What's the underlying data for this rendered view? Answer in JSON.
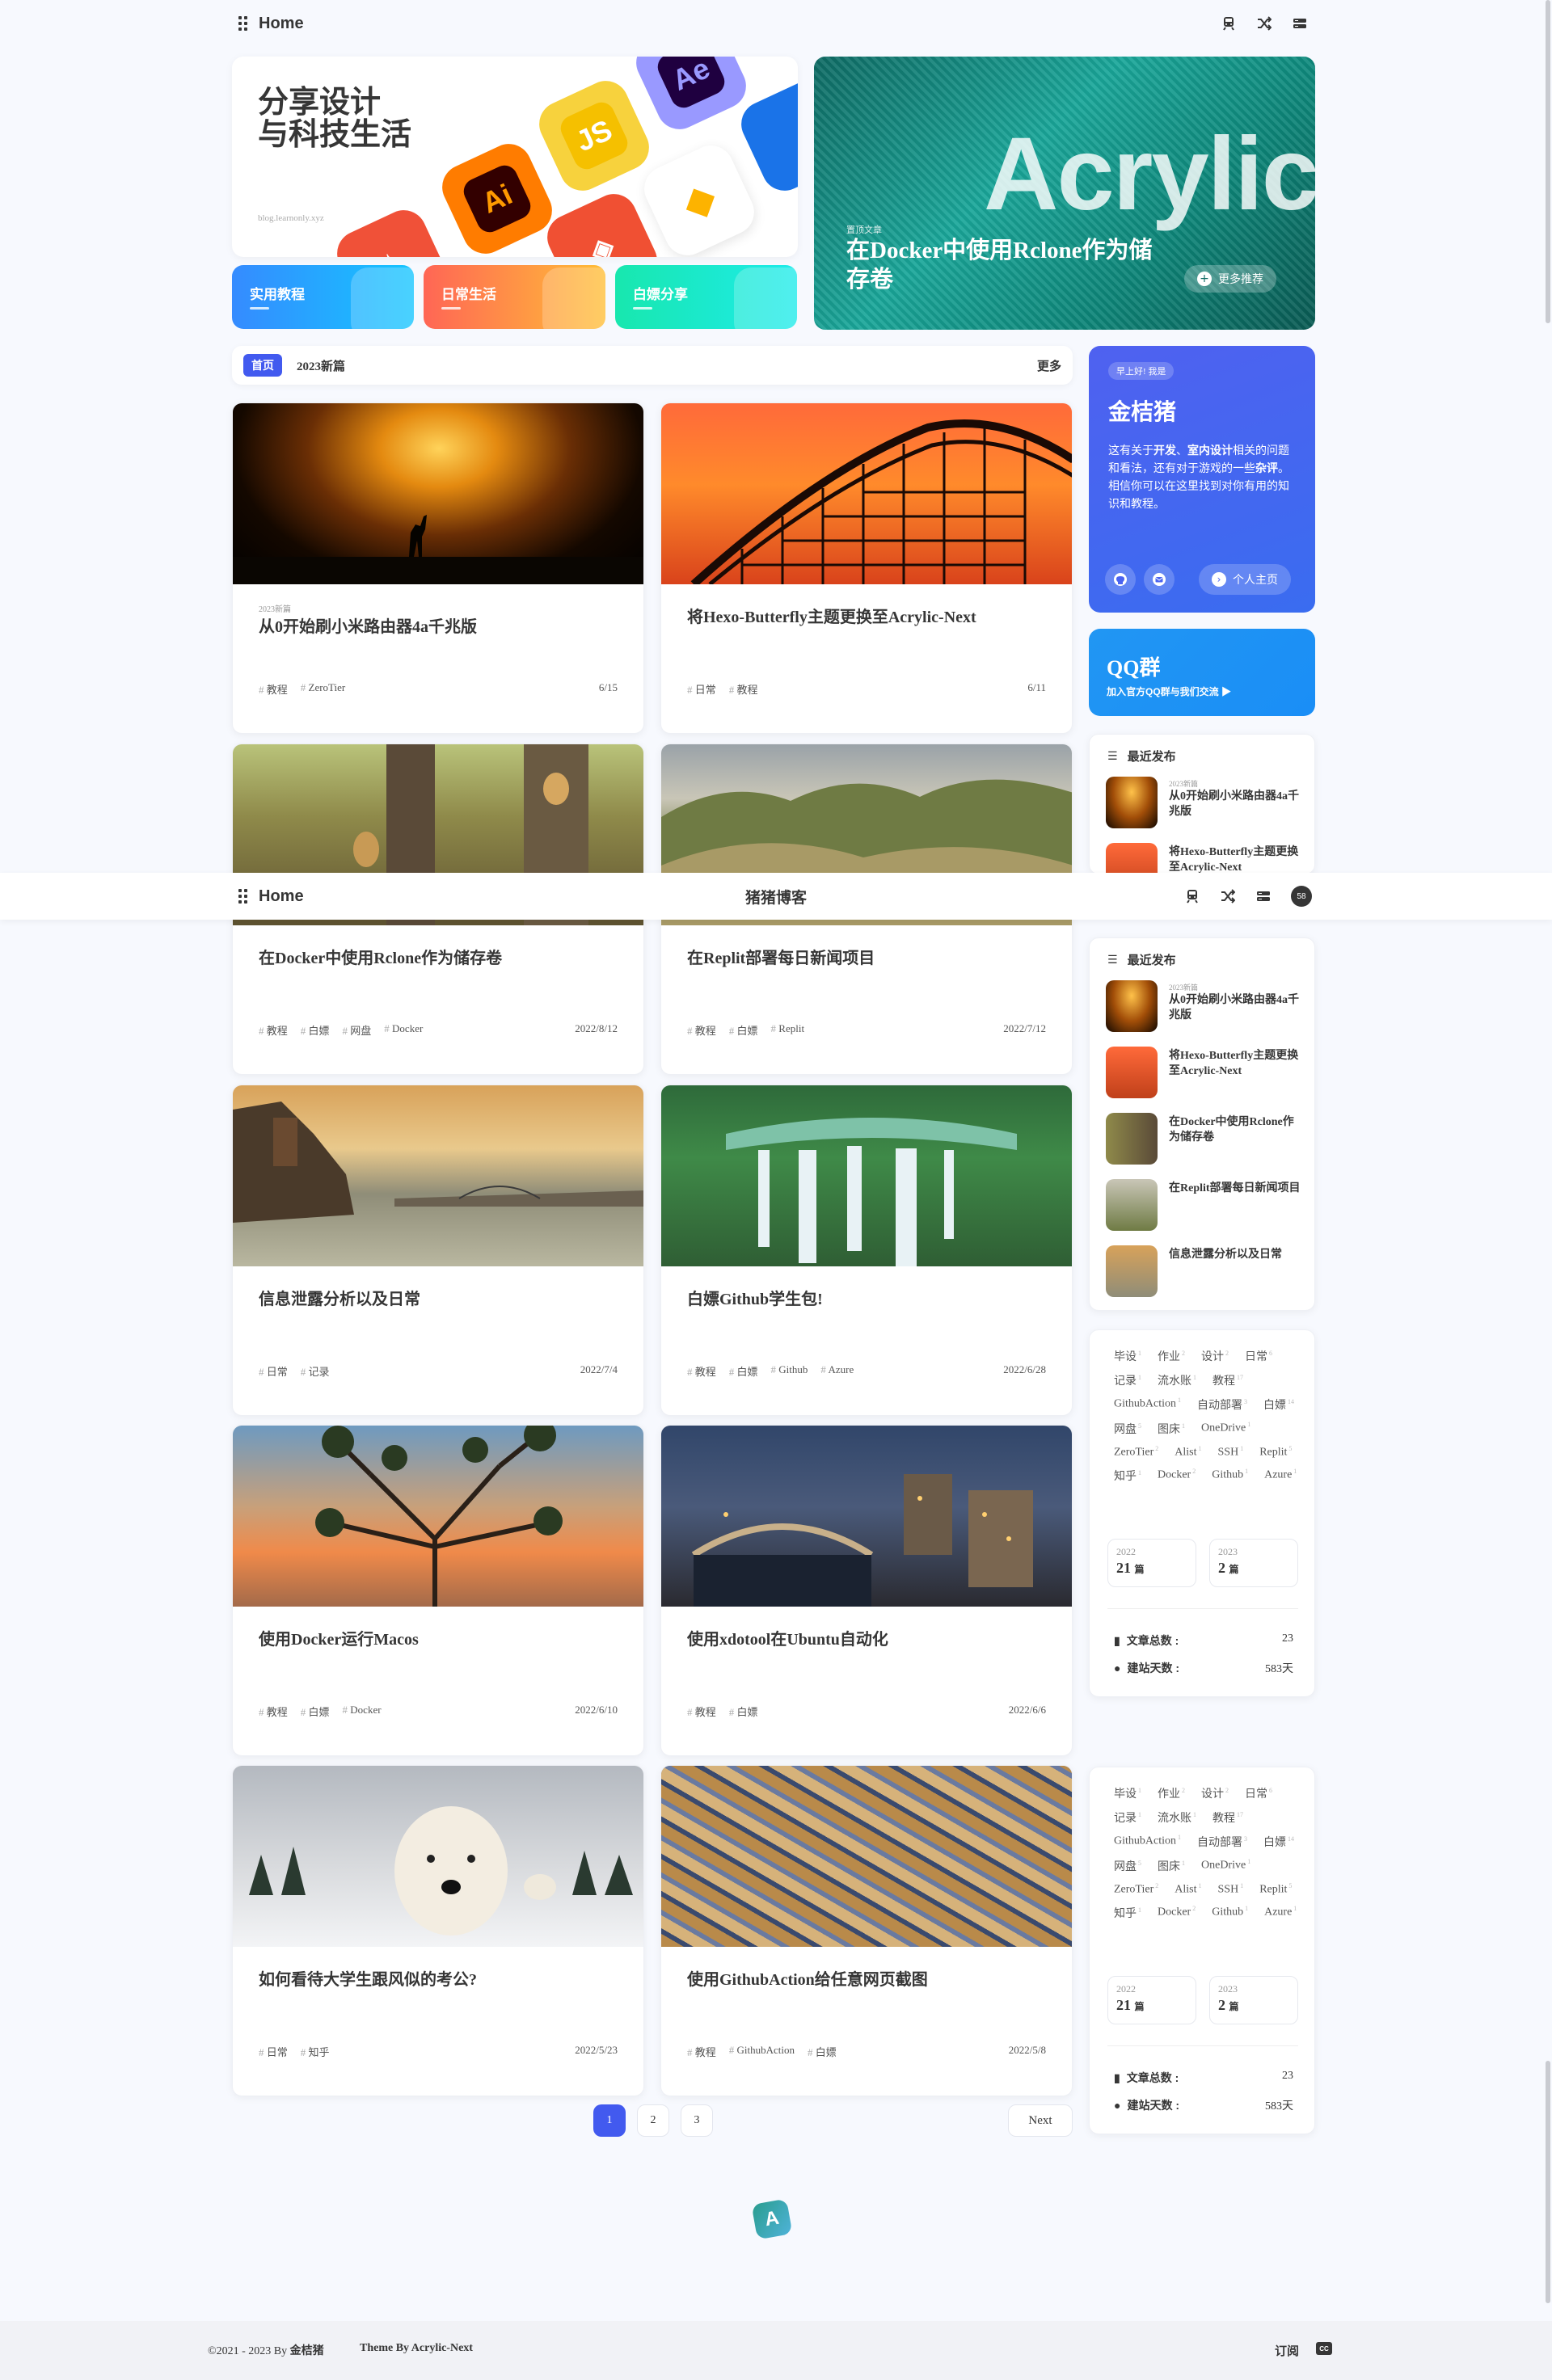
{
  "nav": {
    "home": "Home",
    "site_title": "猪猪博客",
    "icons": [
      "subway-icon",
      "shuffle-icon",
      "list-icon"
    ],
    "badge": "58"
  },
  "hero": {
    "slogan_line1": "分享设计",
    "slogan_line2": "与科技生活",
    "site": "blog.learnonly.xyz",
    "apps": [
      "Ai",
      "JS",
      "Ae"
    ],
    "categories": [
      {
        "label": "实用教程",
        "color": "#358bff"
      },
      {
        "label": "日常生活",
        "color": "#f7743a"
      },
      {
        "label": "白嫖分享",
        "color": "#18e7ae"
      }
    ],
    "featured": {
      "big_word": "Acrylic",
      "tag": "置顶文章",
      "title": "在Docker中使用Rclone作为储存卷",
      "more": "更多推荐"
    }
  },
  "catbar": {
    "pill": "首页",
    "text": "2023新篇",
    "more": "更多"
  },
  "posts": [
    {
      "label": "2023新篇",
      "title": "从0开始刷小米路由器4a千兆版",
      "tags": [
        "教程",
        "ZeroTier"
      ],
      "date": "6/15"
    },
    {
      "label": "",
      "title": "将Hexo-Butterfly主题更换至Acrylic-Next",
      "tags": [
        "日常",
        "教程"
      ],
      "date": "6/11"
    },
    {
      "label": "",
      "title": "在Docker中使用Rclone作为储存卷",
      "tags": [
        "教程",
        "白嫖",
        "网盘",
        "Docker"
      ],
      "date": "2022/8/12"
    },
    {
      "label": "",
      "title": "在Replit部署每日新闻项目",
      "tags": [
        "教程",
        "白嫖",
        "Replit"
      ],
      "date": "2022/7/12"
    },
    {
      "label": "",
      "title": "信息泄露分析以及日常",
      "tags": [
        "日常",
        "记录"
      ],
      "date": "2022/7/4"
    },
    {
      "label": "",
      "title": "白嫖Github学生包!",
      "tags": [
        "教程",
        "白嫖",
        "Github",
        "Azure"
      ],
      "date": "2022/6/28"
    },
    {
      "label": "",
      "title": "使用Docker运行Macos",
      "tags": [
        "教程",
        "白嫖",
        "Docker"
      ],
      "date": "2022/6/10"
    },
    {
      "label": "",
      "title": "使用xdotool在Ubuntu自动化",
      "tags": [
        "教程",
        "白嫖"
      ],
      "date": "2022/6/6"
    },
    {
      "label": "",
      "title": "如何看待大学生跟风似的考公?",
      "tags": [
        "日常",
        "知乎"
      ],
      "date": "2022/5/23"
    },
    {
      "label": "",
      "title": "使用GithubAction给任意网页截图",
      "tags": [
        "教程",
        "GithubAction",
        "白嫖"
      ],
      "date": "2022/5/8"
    }
  ],
  "author": {
    "greet": "早上好! 我是",
    "name": "金桔猪",
    "desc_1": "这有关于",
    "desc_b1": "开发",
    "desc_2": "、",
    "desc_b2": "室内设计",
    "desc_3": "相关的问题和看法，还有对于游戏的一些",
    "desc_b3": "杂评",
    "desc_4": "。",
    "desc_5": "相信你可以在这里找到对你有用的知识和教程。",
    "home_btn": "个人主页"
  },
  "qq": {
    "title": "QQ群",
    "sub": "加入官方QQ群与我们交流 ▶"
  },
  "recent": {
    "heading": "最近发布",
    "items": [
      {
        "label": "2023新篇",
        "title": "从0开始刷小米路由器4a千兆版"
      },
      {
        "label": "",
        "title": "将Hexo-Butterfly主题更换至Acrylic-Next"
      },
      {
        "label": "",
        "title": "在Docker中使用Rclone作为储存卷"
      },
      {
        "label": "",
        "title": "在Replit部署每日新闻项目"
      },
      {
        "label": "",
        "title": "信息泄露分析以及日常"
      }
    ]
  },
  "tags_cloud": [
    {
      "name": "毕设",
      "count": "1"
    },
    {
      "name": "作业",
      "count": "2"
    },
    {
      "name": "设计",
      "count": "2"
    },
    {
      "name": "日常",
      "count": "6"
    },
    {
      "name": "记录",
      "count": "1"
    },
    {
      "name": "流水账",
      "count": "1"
    },
    {
      "name": "教程",
      "count": "17"
    },
    {
      "name": "GithubAction",
      "count": "1"
    },
    {
      "name": "自动部署",
      "count": "3"
    },
    {
      "name": "白嫖",
      "count": "14"
    },
    {
      "name": "网盘",
      "count": "5"
    },
    {
      "name": "图床",
      "count": "1"
    },
    {
      "name": "OneDrive",
      "count": "1"
    },
    {
      "name": "ZeroTier",
      "count": "2"
    },
    {
      "name": "Alist",
      "count": "1"
    },
    {
      "name": "SSH",
      "count": "1"
    },
    {
      "name": "Replit",
      "count": "5"
    },
    {
      "name": "知乎",
      "count": "1"
    },
    {
      "name": "Docker",
      "count": "2"
    },
    {
      "name": "Github",
      "count": "1"
    },
    {
      "name": "Azure",
      "count": "1"
    }
  ],
  "archive": [
    {
      "year": "2022",
      "count": "21",
      "unit": "篇"
    },
    {
      "year": "2023",
      "count": "2",
      "unit": "篇"
    }
  ],
  "stats": [
    {
      "key": "文章总数 :",
      "value": "23"
    },
    {
      "key": "建站天数 :",
      "value": "583天"
    }
  ],
  "pager": {
    "pages": [
      "1",
      "2",
      "3"
    ],
    "next": "Next"
  },
  "footer": {
    "copy_prefix": "©2021 - 2023 By ",
    "copy_name": "金桔猪",
    "theme": "Theme By Acrylic-Next",
    "rss": "订阅",
    "cc": "CC"
  }
}
